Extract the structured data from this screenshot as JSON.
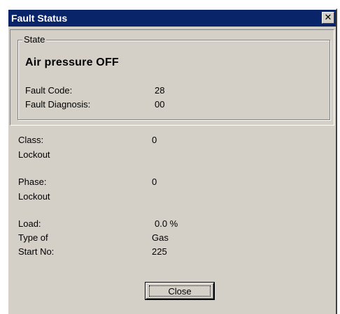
{
  "window": {
    "title": "Fault Status",
    "close_glyph": "✕"
  },
  "state": {
    "legend": "State",
    "title": "Air pressure OFF",
    "fault_code_label": "Fault Code:",
    "fault_code_value": "28",
    "fault_diagnosis_label": "Fault Diagnosis:",
    "fault_diagnosis_value": "00"
  },
  "details": {
    "class_label": "Class:",
    "class_value": "0",
    "class_sub": "Lockout",
    "phase_label": "Phase:",
    "phase_value": "0",
    "phase_sub": "Lockout",
    "load_label": "Load:",
    "load_value": "0.0 %",
    "type_label": "Type of",
    "type_value": "Gas",
    "start_label": "Start No:",
    "start_value": "225"
  },
  "buttons": {
    "close_label": "Close"
  },
  "colors": {
    "titlebar": "#0a246a",
    "face": "#d4d0c8"
  }
}
